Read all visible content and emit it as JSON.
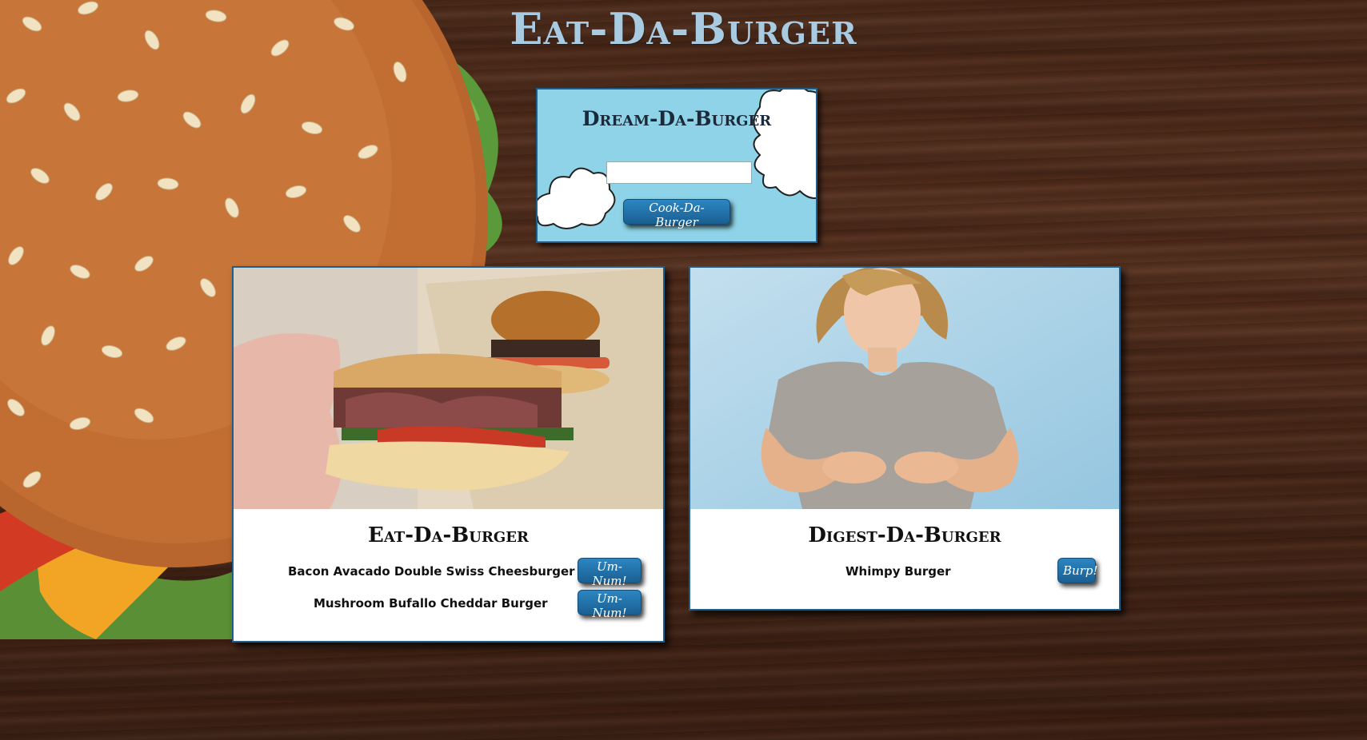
{
  "site": {
    "title": "Eat-Da-Burger"
  },
  "dream": {
    "title": "Dream-Da-Burger",
    "input_value": "",
    "input_placeholder": "",
    "button_label": "Cook-Da-Burger"
  },
  "eat": {
    "title": "Eat-Da-Burger",
    "items": [
      {
        "name": "Bacon Avacado Double Swiss Cheesburger",
        "button_label": "Um-Num!"
      },
      {
        "name": "Mushroom Bufallo Cheddar Burger",
        "button_label": "Um-Num!"
      }
    ]
  },
  "digest": {
    "title": "Digest-Da-Burger",
    "items": [
      {
        "name": "Whimpy Burger",
        "button_label": "Burp!"
      }
    ]
  },
  "colors": {
    "title_blue": "#a9cbe2",
    "panel_sky": "#8ed3e7",
    "button_blue": "#1a5f92",
    "border_blue": "#1c5f8e"
  }
}
